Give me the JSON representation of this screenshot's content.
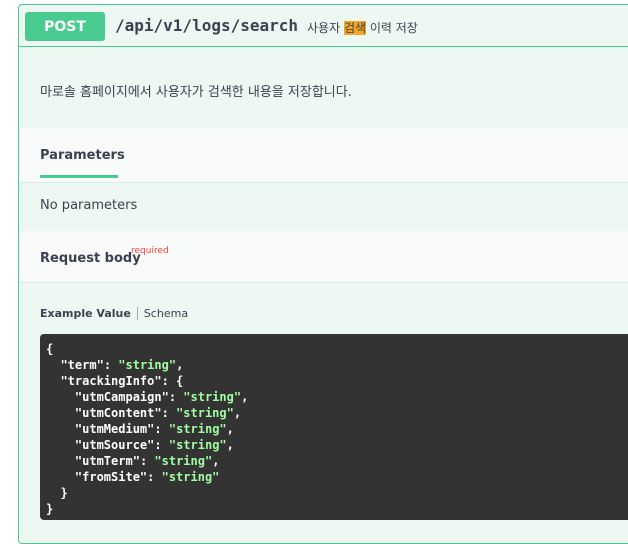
{
  "operation": {
    "method": "POST",
    "path": "/api/v1/logs/search",
    "summary_before": "사용자 ",
    "summary_highlight": "검색",
    "summary_after": " 이력 저장",
    "description": "마로솔 홈페이지에서 사용자가 검색한 내용을 저장합니다."
  },
  "parameters": {
    "tab_label": "Parameters",
    "empty_text": "No parameters"
  },
  "request_body": {
    "title": "Request body",
    "required_label": "required",
    "tab_example": "Example Value",
    "tab_schema": "Schema",
    "code_lines": [
      "{",
      "  \"term\": \"string\",",
      "  \"trackingInfo\": {",
      "    \"utmCampaign\": \"string\",",
      "    \"utmContent\": \"string\",",
      "    \"utmMedium\": \"string\",",
      "    \"utmSource\": \"string\",",
      "    \"utmTerm\": \"string\",",
      "    \"fromSite\": \"string\"",
      "  }",
      "}"
    ]
  },
  "colors": {
    "method_bg": "#49cc90",
    "block_bg": "#edf8f2",
    "highlight": "#f5a623",
    "required": "#f93e3e",
    "code_bg": "#333333",
    "string_color": "#a2fca2"
  }
}
